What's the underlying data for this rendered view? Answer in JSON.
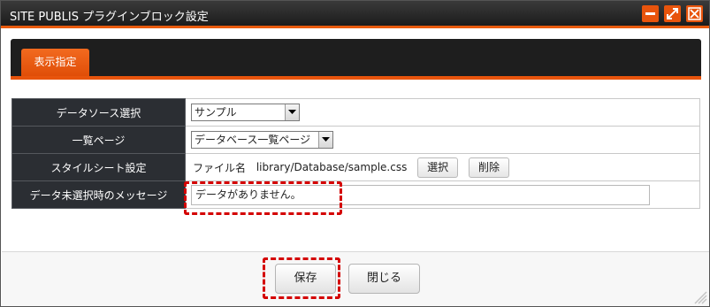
{
  "window": {
    "title": "SITE PUBLIS プラグインブロック設定",
    "accent_color": "#e8540c",
    "controls": [
      "minimize-icon",
      "maximize-icon",
      "close-icon"
    ]
  },
  "tabs": [
    {
      "label": "表示指定",
      "active": true
    }
  ],
  "form": {
    "rows": [
      {
        "label": "データソース選択",
        "select_value": "サンプル"
      },
      {
        "label": "一覧ページ",
        "select_value": "データベース一覧ページ"
      },
      {
        "label": "スタイルシート設定",
        "file_prefix": "ファイル名",
        "file_path": "library/Database/sample.css",
        "select_button": "選択",
        "delete_button": "削除"
      },
      {
        "label": "データ未選択時のメッセージ",
        "input_value": "データがありません。"
      }
    ]
  },
  "footer": {
    "save_label": "保存",
    "close_label": "閉じる"
  }
}
